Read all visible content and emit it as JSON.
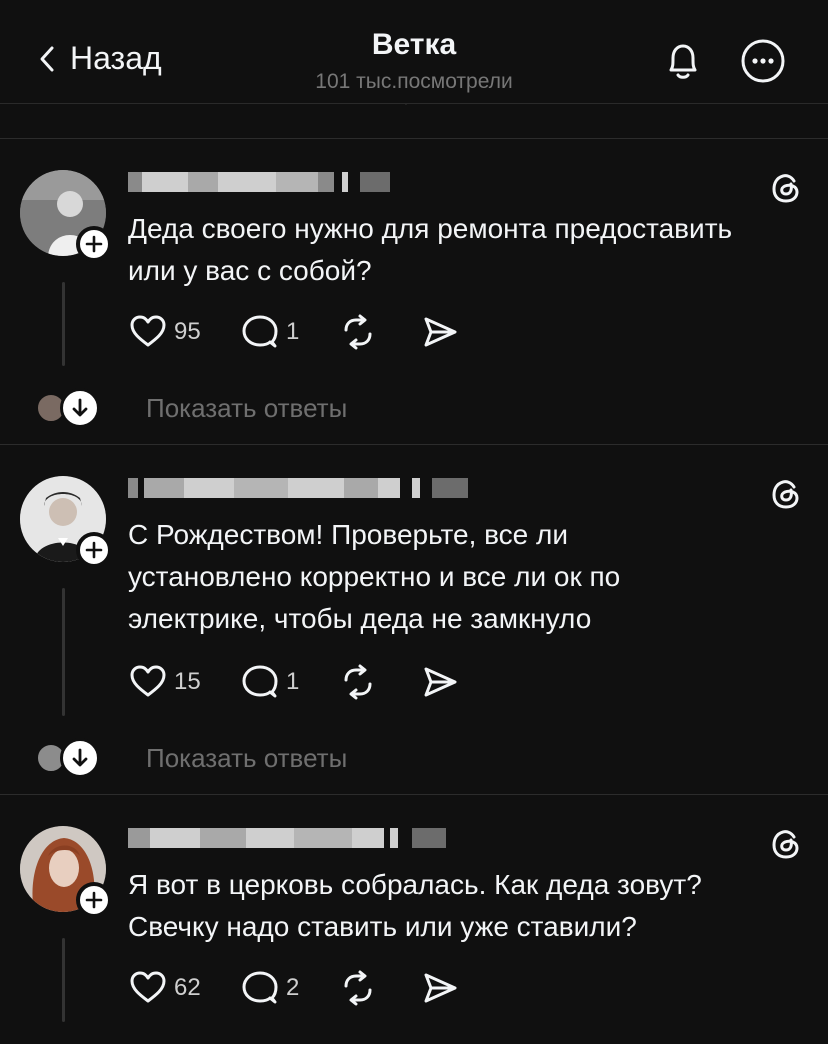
{
  "header": {
    "back_label": "Назад",
    "title": "Ветка",
    "subtitle": "101 тыс.посмотрели"
  },
  "posts": [
    {
      "text_line1": "Деда своего нужно для ремонта предоставить",
      "text_line2": "или у вас с собой?",
      "likes": "95",
      "comments": "1",
      "show_replies": "Показать ответы"
    },
    {
      "text_line1": "С Рождеством! Проверьте, все ли",
      "text_line2": "установлено корректно и все ли ок по",
      "text_line3": "электрике, чтобы деда не замкнуло",
      "likes": "15",
      "comments": "1",
      "show_replies": "Показать ответы"
    },
    {
      "text_line1": "Я вот в церковь собралась. Как деда зовут?",
      "text_line2": "Свечку надо ставить или уже ставили?",
      "likes": "62",
      "comments": "2"
    }
  ],
  "colors": {
    "background": "#101010",
    "text": "#f3f5f7",
    "muted": "#6f6f6f",
    "separator": "#2c2c2c"
  },
  "icons": [
    "chevron-left-icon",
    "bell-icon",
    "more-icon",
    "threads-logo-icon",
    "heart-icon",
    "comment-icon",
    "repost-icon",
    "share-icon",
    "arrow-down-icon",
    "plus-icon"
  ]
}
